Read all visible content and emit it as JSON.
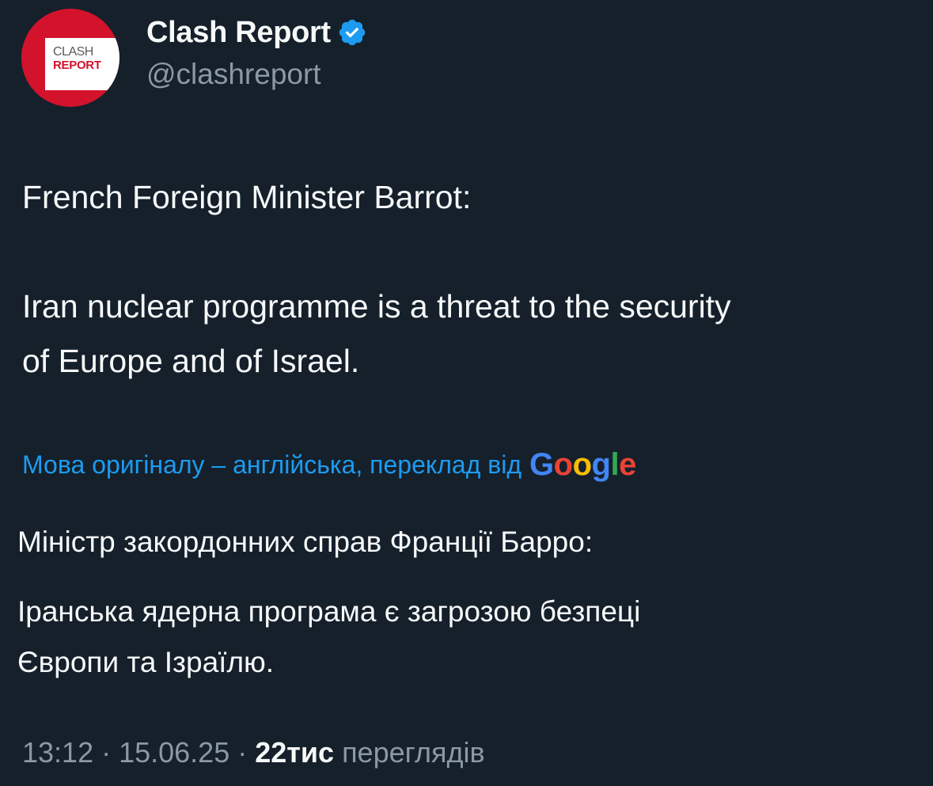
{
  "author": {
    "display_name": "Clash Report",
    "handle": "@clashreport",
    "verified": true,
    "avatar_text_top": "CLASH",
    "avatar_text_bottom": "REPORT",
    "avatar_color": "#d3122c",
    "verified_color": "#1d9bf0"
  },
  "tweet": {
    "lines": [
      "French Foreign Minister Barrot:",
      "Iran nuclear programme is a threat to the security",
      "of Europe and of Israel."
    ]
  },
  "translation": {
    "note": "Мова оригіналу – англійська, переклад від",
    "provider": "Google",
    "text_heading": "Міністр закордонних справ Франції Барро:",
    "text_lines": [
      "Іранська ядерна програма є загрозою безпеці",
      "Європи та Ізраїлю."
    ]
  },
  "meta": {
    "time": "13:12",
    "separator": "·",
    "date": "15.06.25",
    "views_count": "22тис",
    "views_label": "переглядів"
  },
  "colors": {
    "background": "#15202b",
    "text": "#f7f9f9",
    "secondary": "#8b98a5",
    "link": "#1d9bf0"
  }
}
